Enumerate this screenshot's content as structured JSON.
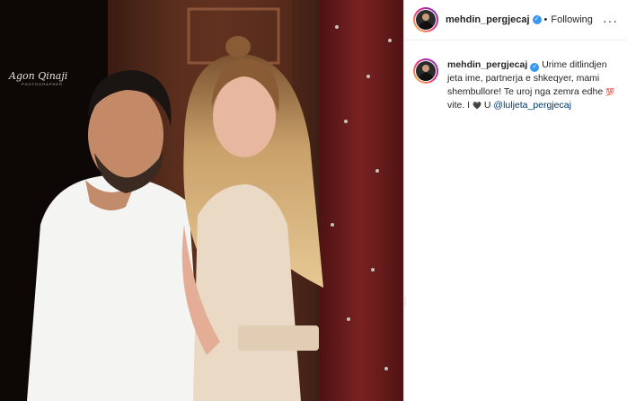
{
  "post": {
    "username": "mehdin_pergjecaj",
    "follow_status": "Following",
    "separator": "•",
    "more_glyph": "···",
    "verified_glyph": "✓",
    "watermark": "Agon Qinaji",
    "watermark_sub": "PHOTOGRAPHER"
  },
  "caption": {
    "username": "mehdin_pergjecaj",
    "text": "Urime ditlindjen jeta ime, partnerja e shkeqyer, mami shembullore! Te uroj nga zemra edhe",
    "emoji_100": "💯",
    "text2": " vite. I ",
    "emoji_heart": "🖤",
    "text3": " U ",
    "mention": "@luljeta_pergjecaj"
  },
  "icons": {
    "avatar": "profile-avatar-icon",
    "verified": "verified-badge-icon",
    "more": "more-options-icon"
  },
  "colors": {
    "link": "#00376b",
    "verified": "#3897f0",
    "border": "#dbdbdb"
  }
}
